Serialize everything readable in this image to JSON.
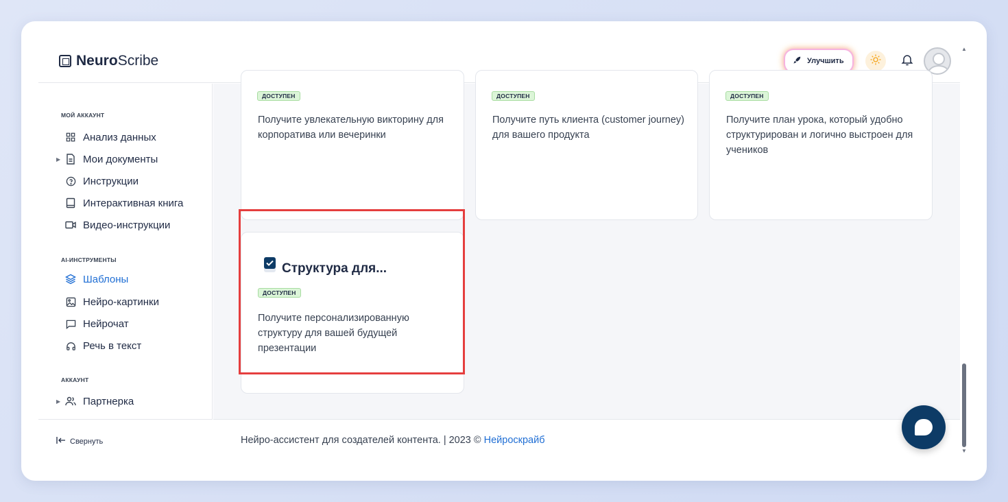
{
  "app": {
    "logo_bold": "Neuro",
    "logo_regular": "Scribe"
  },
  "header": {
    "upgrade_label": "Улучшить",
    "theme_icon": "sun-icon",
    "bell_icon": "bell-icon",
    "avatar_icon": "user-avatar-icon"
  },
  "sidebar": {
    "sections": [
      {
        "title": "МОЙ АККАУНТ"
      },
      {
        "title": "AI-ИНСТРУМЕНТЫ"
      },
      {
        "title": "АККАУНТ"
      }
    ],
    "items": [
      {
        "label": "Анализ данных",
        "icon": "grid-icon"
      },
      {
        "label": "Мои документы",
        "icon": "document-icon",
        "expandable": true
      },
      {
        "label": "Инструкции",
        "icon": "help-circle-icon"
      },
      {
        "label": "Интерактивная книга",
        "icon": "book-icon"
      },
      {
        "label": "Видео-инструкции",
        "icon": "video-icon"
      },
      {
        "label": "Шаблоны",
        "icon": "layers-icon",
        "active": true
      },
      {
        "label": "Нейро-картинки",
        "icon": "image-icon"
      },
      {
        "label": "Нейрочат",
        "icon": "chat-icon"
      },
      {
        "label": "Речь в текст",
        "icon": "headphones-icon"
      },
      {
        "label": "Партнерка",
        "icon": "users-icon",
        "expandable": true
      }
    ],
    "collapse_label": "Свернуть",
    "collapse_icon": "collapse-left-icon"
  },
  "cards": [
    {
      "badge": "ДОСТУПЕН",
      "description": "Получите увлекательную викторину для корпоратива или вечеринки"
    },
    {
      "badge": "ДОСТУПЕН",
      "description": "Получите путь клиента (customer journey) для вашего продукта"
    },
    {
      "badge": "ДОСТУПЕН",
      "description": "Получите план урока, который удобно структурирован и логично выстроен для учеников"
    },
    {
      "title": "Структура для...",
      "badge": "ДОСТУПЕН",
      "description": "Получите персонализированную структуру для вашей будущей презентации",
      "icon": "checkbox-icon",
      "highlighted": true
    }
  ],
  "footer": {
    "text": "Нейро-ассистент для создателей контента.  | 2023 © ",
    "link": "Нейроскрайб"
  },
  "chat": {
    "icon": "chat-bubble-icon"
  },
  "colors": {
    "accent": "#1f6ed4",
    "badge_bg": "#dcf5d8",
    "highlight": "#e53e3e",
    "chat_fab": "#0d3b66"
  }
}
